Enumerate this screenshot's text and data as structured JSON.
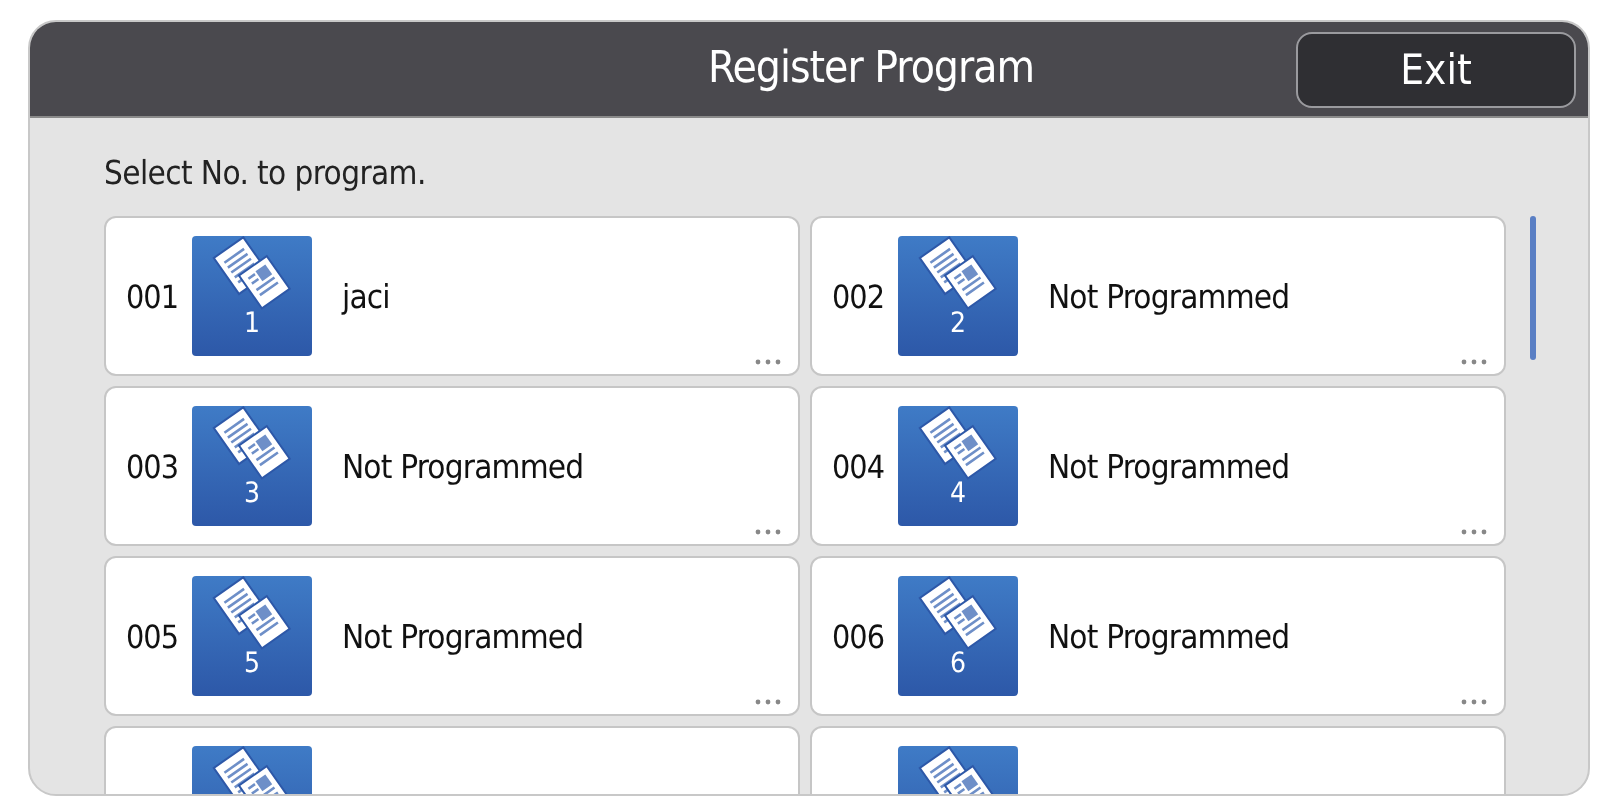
{
  "header": {
    "title": "Register Program",
    "exit_button": "Exit"
  },
  "instruction": "Select No. to program.",
  "programs": [
    {
      "kind": "full",
      "number": "001",
      "icon_number": "1",
      "name": "jaci"
    },
    {
      "kind": "full",
      "number": "002",
      "icon_number": "2",
      "name": "Not Programmed"
    },
    {
      "kind": "full",
      "number": "003",
      "icon_number": "3",
      "name": "Not Programmed"
    },
    {
      "kind": "full",
      "number": "004",
      "icon_number": "4",
      "name": "Not Programmed"
    },
    {
      "kind": "full",
      "number": "005",
      "icon_number": "5",
      "name": "Not Programmed"
    },
    {
      "kind": "full",
      "number": "006",
      "icon_number": "6",
      "name": "Not Programmed"
    },
    {
      "kind": "cut"
    },
    {
      "kind": "cut"
    }
  ]
}
